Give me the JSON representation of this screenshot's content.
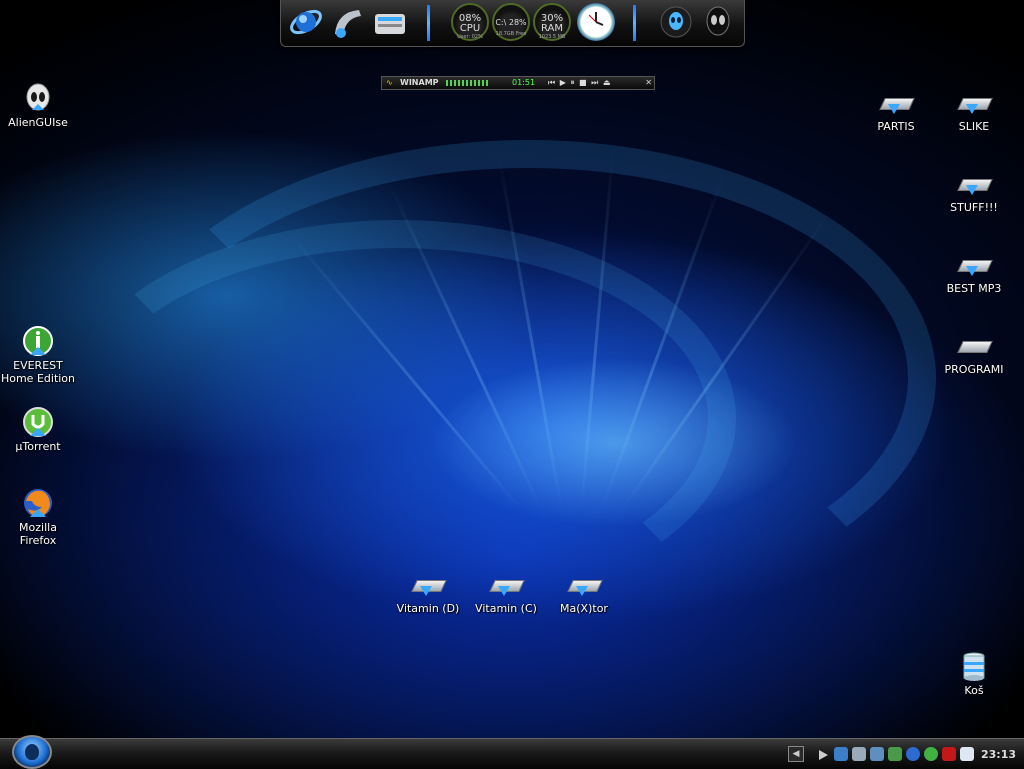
{
  "dock": {
    "left_items": [
      "internet-explorer-icon",
      "music-icon",
      "system-icon"
    ],
    "cpu": {
      "percent": "08%",
      "label": "CPU",
      "sub": "User: 02%"
    },
    "disk": {
      "percent": "C:\\ 28%",
      "label": "",
      "sub": "18,7GB Free"
    },
    "ram": {
      "percent": "30%",
      "label": "RAM",
      "sub": "1023.5 MB"
    },
    "right_items": [
      "alienware-orb-icon",
      "alien-head-icon"
    ]
  },
  "winamp": {
    "title": "WINAMP",
    "time": "01:51"
  },
  "desktop_icons": {
    "left": [
      {
        "label": "AlienGUIse",
        "icon": "alien-head-icon"
      },
      {
        "label": "EVEREST Home Edition",
        "icon": "everest-icon"
      },
      {
        "label": "µTorrent",
        "icon": "utorrent-icon"
      },
      {
        "label": "Mozilla Firefox",
        "icon": "firefox-icon"
      }
    ],
    "right": [
      {
        "label": "PARTIS"
      },
      {
        "label": "SLIKE"
      },
      {
        "label": "STUFF!!!"
      },
      {
        "label": "BEST MP3"
      },
      {
        "label": "PROGRAMI"
      },
      {
        "label": "Koš"
      }
    ],
    "drives": [
      {
        "label": "Vitamin (D)"
      },
      {
        "label": "Vitamin (C)"
      },
      {
        "label": "Ma(X)tor"
      }
    ]
  },
  "taskbar": {
    "clock": "23:13",
    "tray_icons": [
      "play-icon",
      "network-icon",
      "monitor-icon",
      "speaker-icon",
      "shield-icon",
      "wifi-icon",
      "messenger-icon",
      "ati-icon",
      "mail-icon"
    ],
    "accent": "#3aa7ff"
  }
}
